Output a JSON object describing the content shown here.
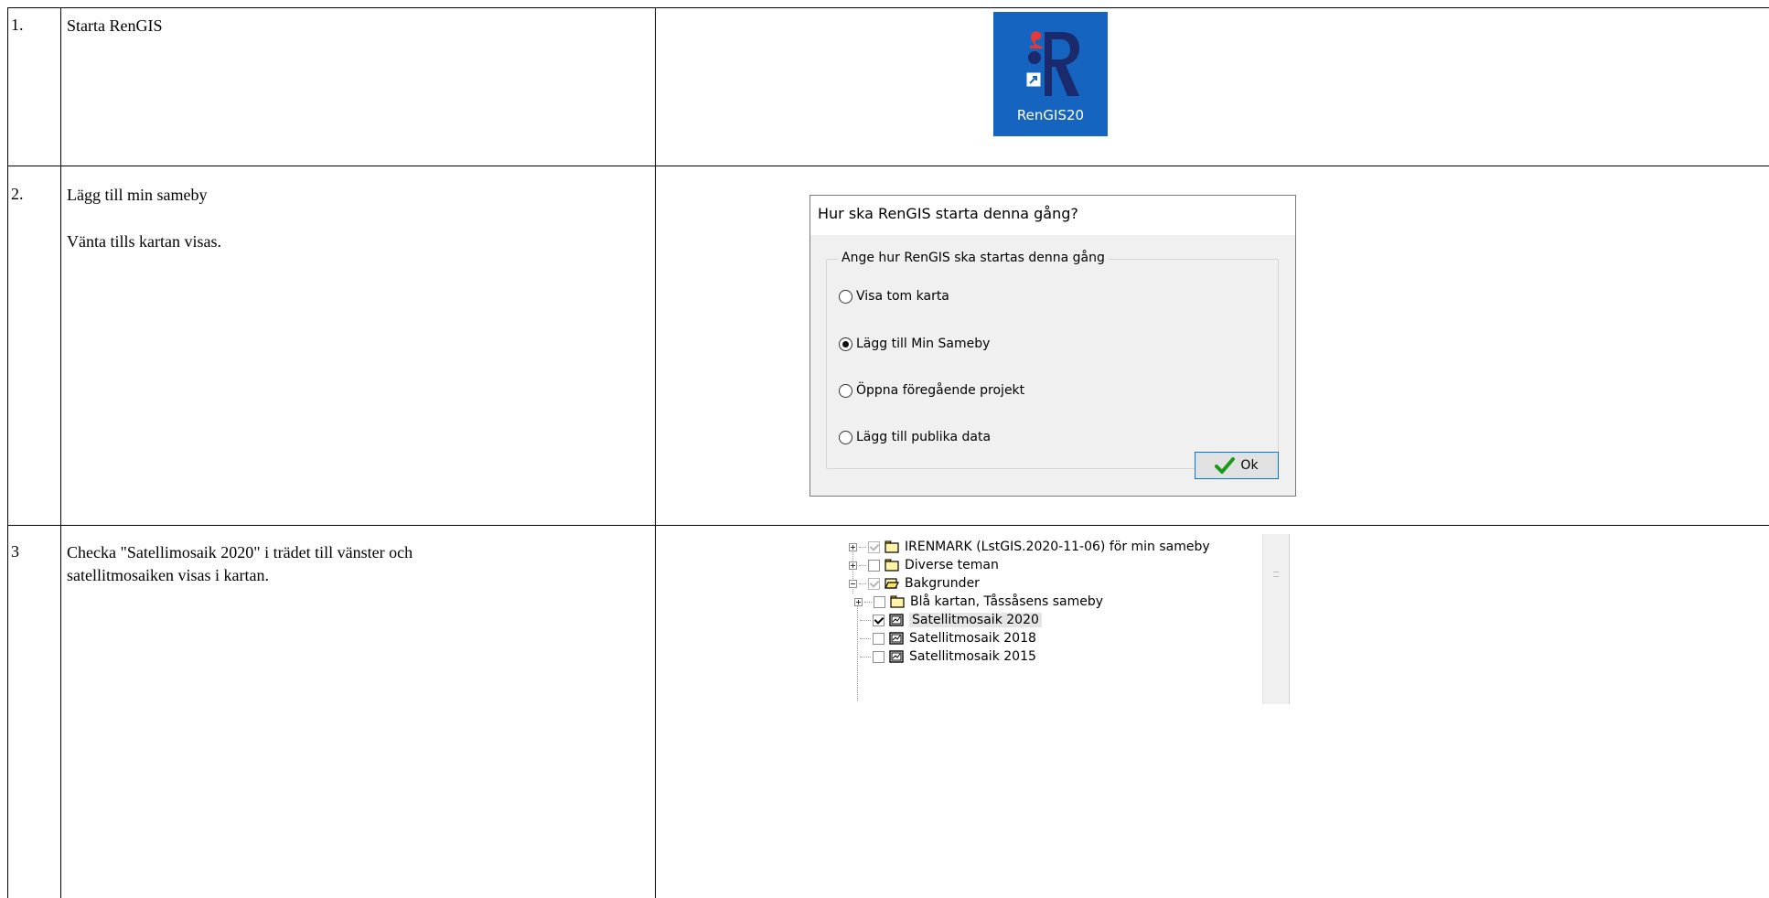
{
  "steps": [
    {
      "number": "1.",
      "lines": [
        "Starta RenGIS"
      ]
    },
    {
      "number": "2.",
      "lines": [
        "Lägg till min sameby",
        "Vänta tills kartan visas."
      ]
    },
    {
      "number": "3",
      "lines": [
        "Checka \"Satellimosaik 2020\" i trädet till vänster och",
        "satellitmosaiken visas i kartan."
      ]
    }
  ],
  "desktop_icon": {
    "label": "RenGIS20",
    "icon": "rengis-app-icon",
    "background": "#1565c0"
  },
  "dialog": {
    "title": "Hur ska RenGIS starta denna gång?",
    "group_label": "Ange hur RenGIS ska startas denna gång",
    "options": [
      {
        "label": "Visa tom karta",
        "selected": false
      },
      {
        "label": "Lägg till Min Sameby",
        "selected": true
      },
      {
        "label": "Öppna föregående projekt",
        "selected": false
      },
      {
        "label": "Lägg till publika data",
        "selected": false
      }
    ],
    "ok_label": "Ok",
    "ok_icon": "green-checkmark-icon"
  },
  "tree": {
    "nodes": [
      {
        "label": "IRENMARK (LstGIS.2020-11-06) för min sameby",
        "checked": true,
        "enabled": false,
        "expander": "plus",
        "icon": "folder-closed-icon"
      },
      {
        "label": "Diverse teman",
        "checked": false,
        "enabled": true,
        "expander": "plus",
        "icon": "folder-closed-icon"
      },
      {
        "label": "Bakgrunder",
        "checked": true,
        "enabled": false,
        "expander": "minus",
        "icon": "folder-open-icon"
      },
      {
        "label": "Blå kartan, Tåssåsens sameby",
        "checked": false,
        "enabled": true,
        "expander": "plus",
        "icon": "folder-closed-icon"
      },
      {
        "label": "Satellitmosaik 2020",
        "checked": true,
        "enabled": true,
        "selected": true,
        "icon": "raster-layer-icon"
      },
      {
        "label": "Satellitmosaik 2018",
        "checked": false,
        "enabled": true,
        "icon": "raster-layer-icon"
      },
      {
        "label": "Satellitmosaik 2015",
        "checked": false,
        "enabled": true,
        "icon": "raster-layer-icon"
      }
    ]
  }
}
